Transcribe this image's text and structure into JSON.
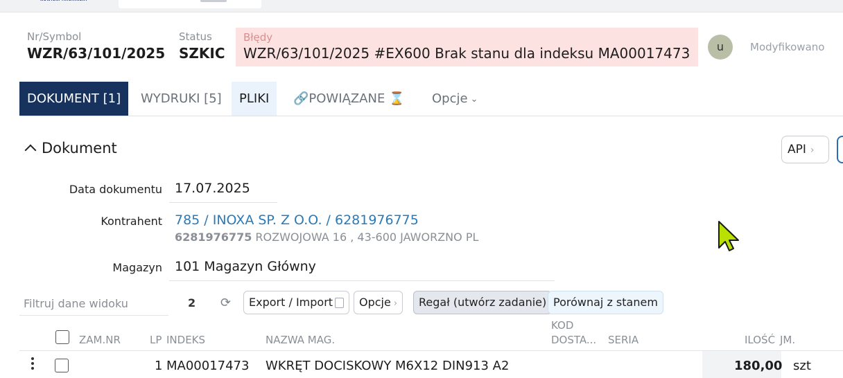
{
  "header": {
    "nr_label": "Nr/Symbol",
    "nr_value": "WZR/63/101/2025",
    "status_label": "Status",
    "status_value": "SZKIC",
    "errors_label": "Błędy",
    "errors_value": "WZR/63/101/2025 #EX600 Brak stanu dla indeksu MA00017473",
    "avatar_letter": "u",
    "modified_label": "Modyfikowano"
  },
  "tabs": [
    {
      "label": "DOKUMENT [1]"
    },
    {
      "label": "WYDRUKI [5]"
    },
    {
      "label": "PLIKI"
    },
    {
      "label": "🔗POWIĄZANE ⌛"
    },
    {
      "label": "Opcje"
    }
  ],
  "section": {
    "title": "Dokument",
    "api_label": "API"
  },
  "fields": {
    "date_label": "Data dokumentu",
    "date_value": "17.07.2025",
    "contractor_label": "Kontrahent",
    "contractor_value": "785 / INOXA SP. Z O.O. / 6281976775",
    "contractor_nip": "6281976775",
    "contractor_address": "ROZWOJOWA 16 , 43-600 JAWORZNO PL",
    "warehouse_label": "Magazyn",
    "warehouse_value": "101 Magazyn Główny"
  },
  "toolbar": {
    "filter_placeholder": "Filtruj dane widoku",
    "count": "2",
    "export_label": "Export / Import",
    "options_label": "Opcje",
    "rack_label": "Regał (utwórz zadanie)",
    "compare_label": "Porównaj z stanem"
  },
  "table": {
    "columns": [
      "ZAM.NR",
      "LP",
      "INDEKS",
      "NAZWA MAG.",
      "KOD",
      "DOSTA...",
      "SERIA",
      "ILOŚĆ",
      "JM."
    ],
    "rows": [
      {
        "lp": "1",
        "index": "MA00017473",
        "name": "WKRĘT DOCISKOWY M6X12 DIN913 A2",
        "qty": "180,00",
        "unit": "szt"
      }
    ]
  },
  "colors": {
    "active_tab": "#18325e",
    "error_bg": "#fde2e2",
    "link": "#2a7ab8",
    "cursor": "#b8e000"
  }
}
